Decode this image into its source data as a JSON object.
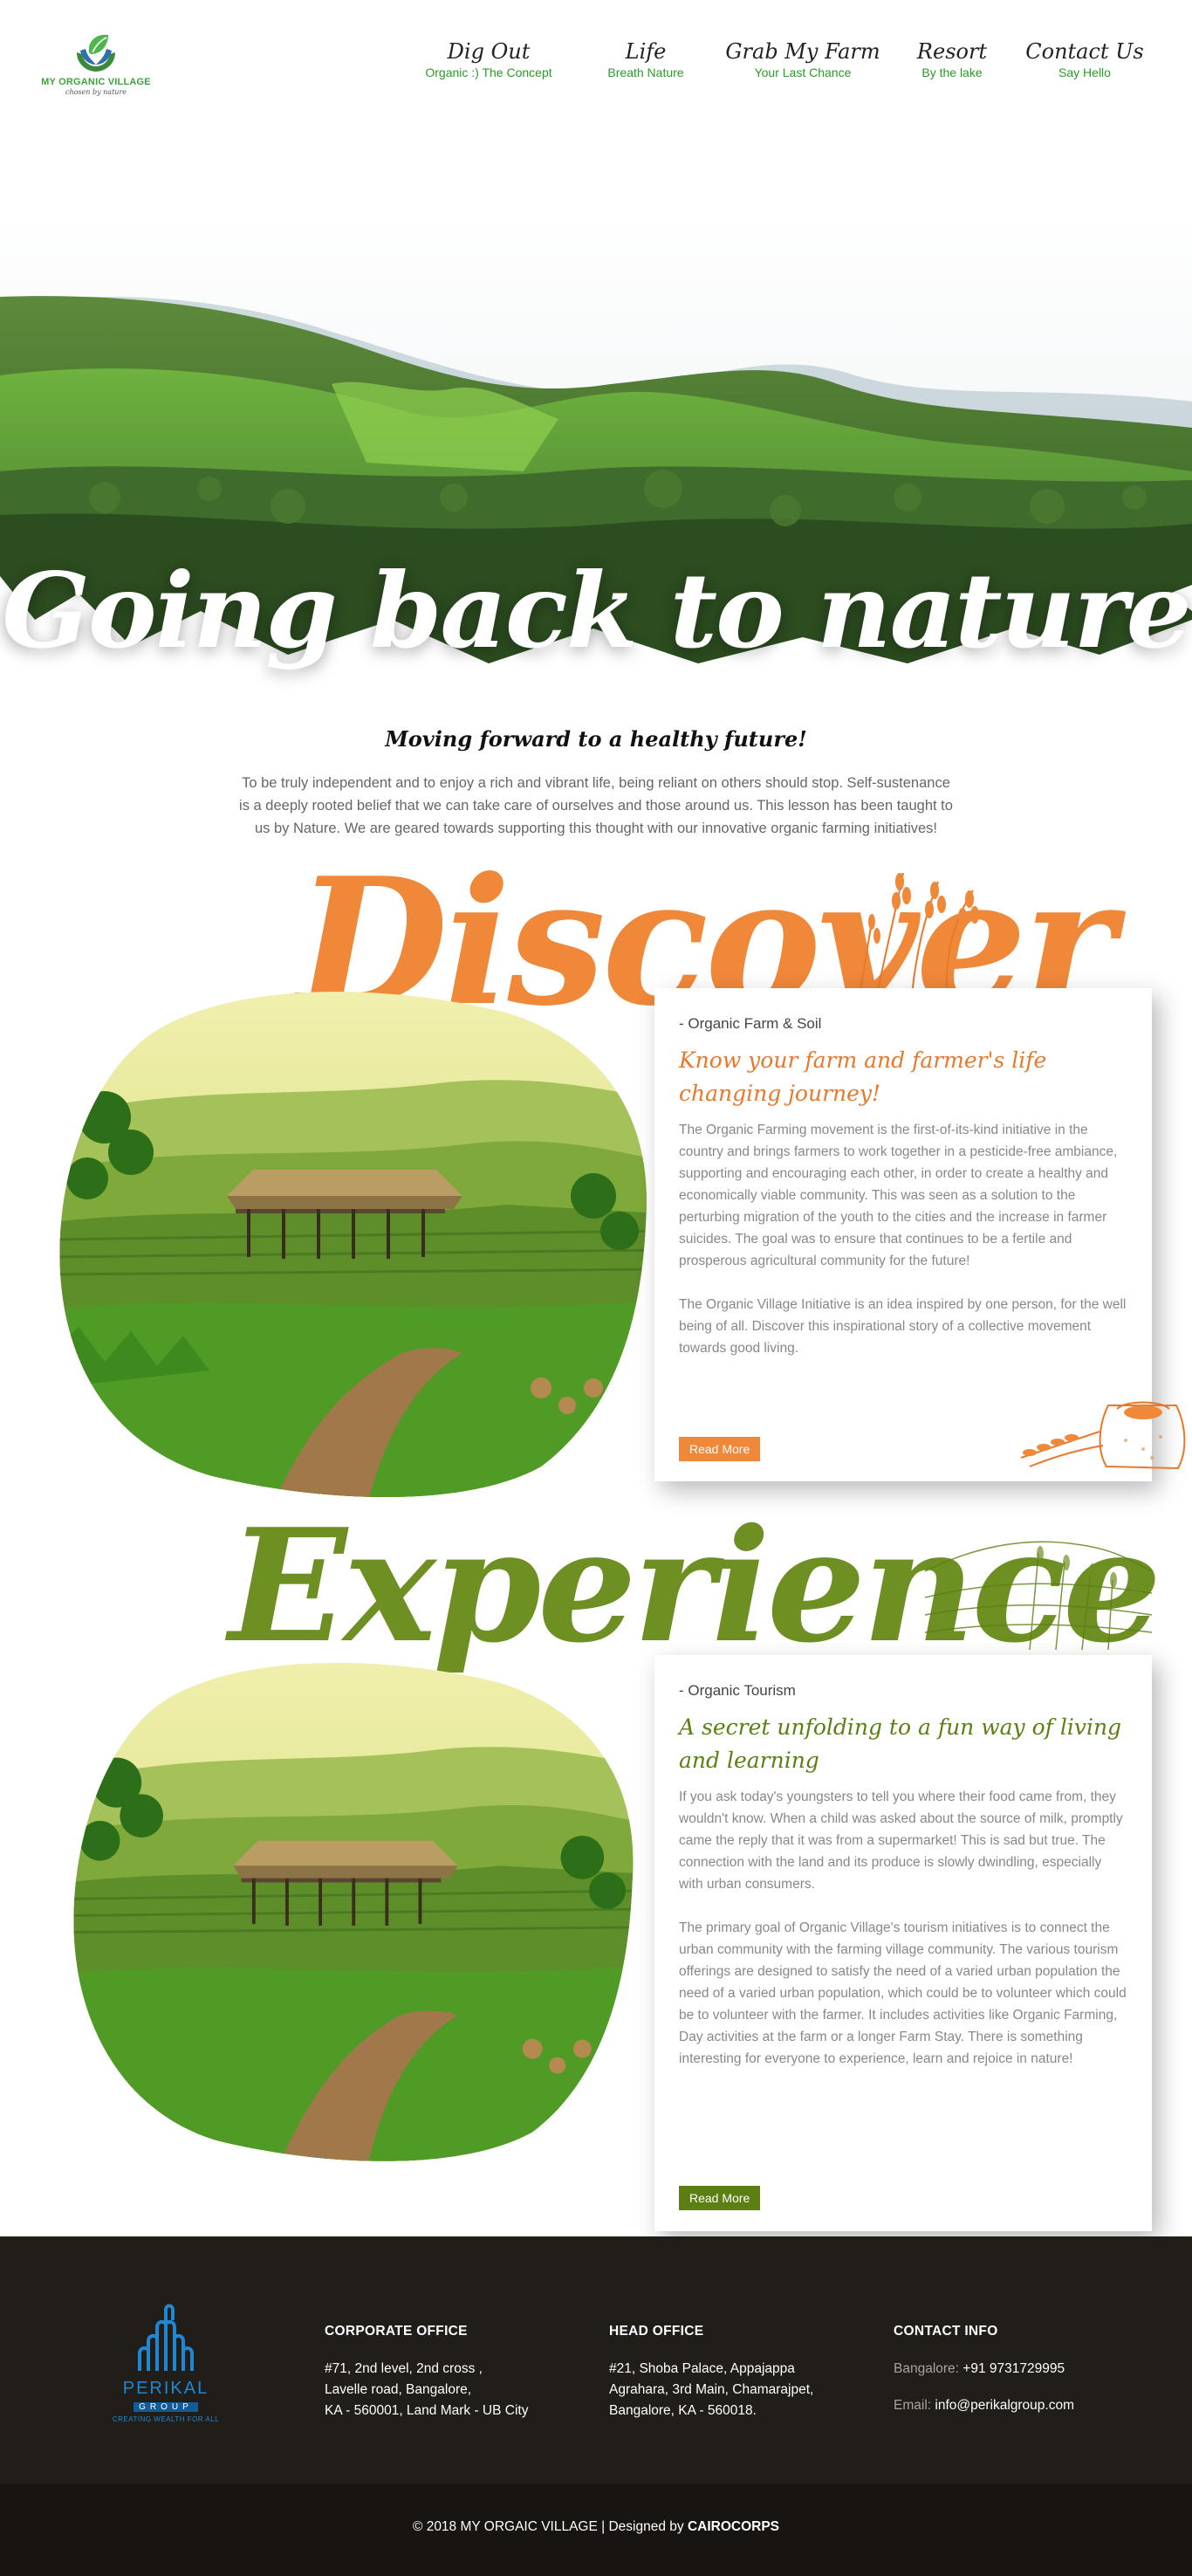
{
  "header": {
    "logo": {
      "brand": "MY ORGANIC VILLAGE",
      "tagline": "chosen by nature"
    },
    "nav": [
      {
        "label": "Dig Out",
        "sub": "Organic :) The Concept"
      },
      {
        "label": "Life",
        "sub": "Breath Nature"
      },
      {
        "label": "Grab My Farm",
        "sub": "Your Last Chance"
      },
      {
        "label": "Resort",
        "sub": "By the lake"
      },
      {
        "label": "Contact Us",
        "sub": "Say Hello"
      }
    ]
  },
  "hero": {
    "title": "Going back to nature"
  },
  "intro": {
    "title": "Moving forward to a healthy future!",
    "text": "To be truly independent and to enjoy a rich and vibrant life, being reliant on others should stop.  Self-sustenance is a deeply rooted belief that we can take care of ourselves and those around us.  This lesson has been taught to us by Nature.  We are geared towards supporting this thought with our innovative organic farming initiatives!"
  },
  "discover": {
    "word": "Discover",
    "eyebrow": "- Organic Farm & Soil",
    "heading": "Know your farm and farmer's life changing journey!",
    "paragraph_1": "The Organic Farming movement is the first-of-its-kind initiative in the country and brings farmers to work together in a pesticide-free ambiance, supporting and encouraging each other, in order to create a healthy and economically viable community. This was seen as a solution to the perturbing migration of the youth to the cities and the increase in farmer suicides. The goal was to ensure that continues to be a fertile and prosperous agricultural community for the future!",
    "paragraph_2": "The Organic Village Initiative is an idea inspired by one person, for the well being of all. Discover this inspirational story of a collective movement towards good living.",
    "button": "Read More"
  },
  "experience": {
    "word": "Experience",
    "eyebrow": "- Organic Tourism",
    "heading": "A secret unfolding to a fun way of living and learning",
    "paragraph_1": "If you ask today's youngsters to tell you where their food came from, they wouldn't know. When a child was asked about the source of milk, promptly came the reply that it was from a supermarket! This is sad but true. The connection with the land and its produce is slowly dwindling, especially with urban consumers.",
    "paragraph_2": "The primary goal of Organic Village's tourism initiatives is to connect the urban community with the farming village community. The various tourism offerings are designed to satisfy the need of a varied urban population the need of a varied urban population, which could be to volunteer which could be to volunteer with the farmer. It includes activities like Organic Farming, Day activities at the farm or a longer Farm Stay. There is something interesting for everyone to experience, learn and rejoice in nature!",
    "button": "Read More"
  },
  "footer": {
    "perikal": {
      "name": "PERIKAL",
      "group": "GROUP",
      "tagline": "CREATING WEALTH FOR ALL"
    },
    "corporate": {
      "title": "CORPORATE OFFICE",
      "lines": [
        "#71, 2nd level, 2nd cross ,",
        "Lavelle road, Bangalore,",
        "KA - 560001, Land Mark - UB City"
      ]
    },
    "head": {
      "title": "HEAD OFFICE",
      "lines": [
        "#21, Shoba Palace, Appajappa",
        "Agrahara, 3rd Main, Chamarajpet,",
        "Bangalore, KA - 560018."
      ]
    },
    "contact": {
      "title": "CONTACT INFO",
      "phone_label": "Bangalore: ",
      "phone": "+91 9731729995",
      "email_label": "Email: ",
      "email": "info@perikalgroup.com"
    },
    "copyright_prefix": "© 2018 MY ORGAIC VILLAGE | Designed by ",
    "copyright_brand": "CAIROCORPS"
  },
  "colors": {
    "orange": "#f0883a",
    "green": "#5b7f12",
    "nav_sub": "#2a9b2a",
    "footer_bg": "#211d19"
  }
}
